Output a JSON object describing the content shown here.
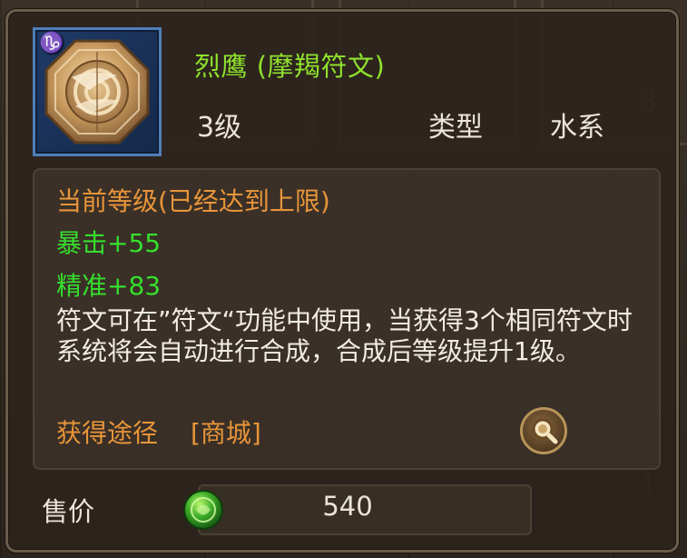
{
  "item": {
    "zodiac_glyph": "♑",
    "title": "烈鹰 (摩羯符文)",
    "level": "3级",
    "type_label": "类型",
    "type_value": "水系"
  },
  "details": {
    "status": "当前等级(已经达到上限)",
    "stats": [
      "暴击+55",
      "精准+83"
    ],
    "description": "符文可在”符文“功能中使用，当获得3个相同符文时系统将会自动进行合成，合成后等级提升1级。",
    "source_label": "获得途径",
    "source_value": "[商城]"
  },
  "price": {
    "label": "售价",
    "value": "540"
  },
  "icons": {
    "rune": "capricorn-rune-icon",
    "search": "magnifier-icon",
    "currency": "jade-coin-icon"
  },
  "colors": {
    "title": "#8fe22d",
    "stat": "#35df2d",
    "status": "#e8953a",
    "text": "#ebe4d8",
    "icon_frame": "#4f7fb8"
  }
}
